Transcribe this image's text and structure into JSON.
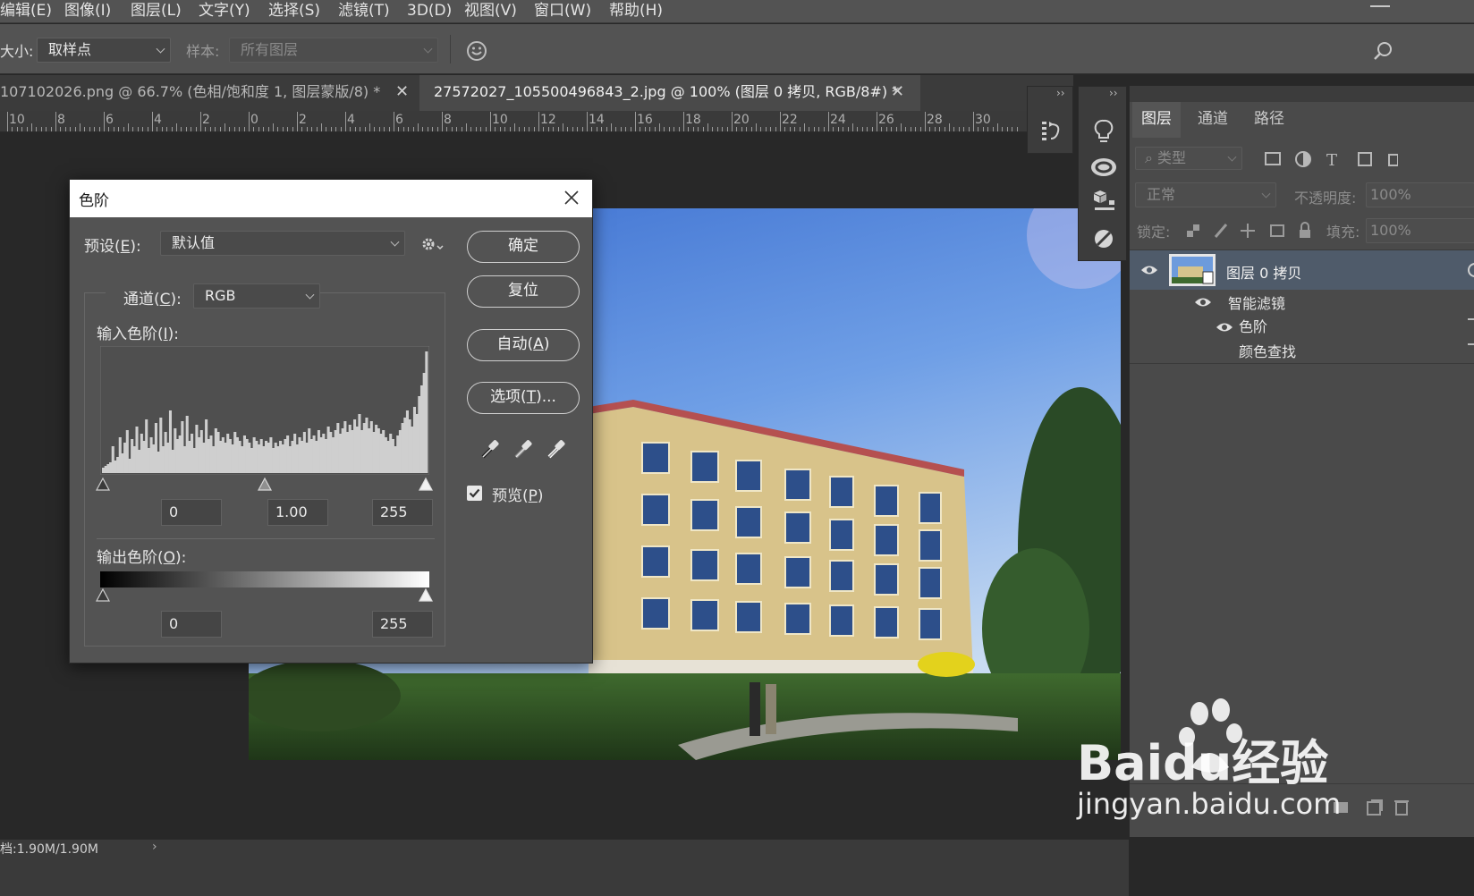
{
  "menu": {
    "items": [
      "编辑(E)",
      "图像(I)",
      "图层(L)",
      "文字(Y)",
      "选择(S)",
      "滤镜(T)",
      "3D(D)",
      "视图(V)",
      "窗口(W)",
      "帮助(H)"
    ]
  },
  "options": {
    "size_label": "大小:",
    "size_value": "取样点",
    "sample_label": "样本:",
    "sample_value": "所有图层"
  },
  "tabs": [
    {
      "label": "107102026.png @ 66.7% (色相/饱和度 1, 图层蒙版/8) *"
    },
    {
      "label": "27572027_105500496843_2.jpg @ 100% (图层 0 拷贝, RGB/8#) *"
    }
  ],
  "ruler": {
    "labels": [
      "10",
      "8",
      "6",
      "4",
      "2",
      "0",
      "2",
      "4",
      "6",
      "8",
      "10",
      "12",
      "14",
      "16",
      "18",
      "20",
      "22",
      "24",
      "26",
      "28",
      "30"
    ]
  },
  "dialog": {
    "title": "色阶",
    "preset_label": "预设(E):",
    "preset_value": "默认值",
    "channel_label": "通道(C):",
    "channel_value": "RGB",
    "input_label": "输入色阶(I):",
    "input_black": "0",
    "input_gamma": "1.00",
    "input_white": "255",
    "output_label": "输出色阶(O):",
    "output_black": "0",
    "output_white": "255",
    "ok": "确定",
    "reset": "复位",
    "auto": "自动(A)",
    "options": "选项(T)...",
    "preview_label": "预览(P)",
    "preview_checked": true,
    "histogram": [
      6,
      8,
      10,
      12,
      30,
      14,
      18,
      40,
      22,
      34,
      48,
      16,
      38,
      30,
      52,
      26,
      44,
      36,
      60,
      28,
      40,
      32,
      56,
      24,
      62,
      30,
      46,
      34,
      70,
      26,
      50,
      38,
      42,
      58,
      30,
      64,
      36,
      44,
      28,
      54,
      40,
      48,
      34,
      60,
      38,
      42,
      30,
      50,
      46,
      36,
      40,
      34,
      44,
      38,
      32,
      46,
      40,
      36,
      30,
      42,
      38,
      34,
      28,
      40,
      36,
      32,
      38,
      30,
      36,
      34,
      40,
      28,
      34,
      30,
      36,
      32,
      38,
      42,
      30,
      36,
      44,
      32,
      40,
      36,
      46,
      34,
      50,
      38,
      42,
      36,
      48,
      40,
      44,
      38,
      52,
      46,
      40,
      48,
      56,
      44,
      50,
      58,
      46,
      54,
      48,
      60,
      52,
      66,
      48,
      56,
      62,
      50,
      58,
      46,
      54,
      50,
      44,
      48,
      40,
      36,
      44,
      38,
      30,
      42,
      48,
      56,
      62,
      70,
      60,
      52,
      74,
      66,
      86,
      98,
      112,
      136
    ],
    "histogram_max": 140
  },
  "layers_panel": {
    "tabs": [
      "图层",
      "通道",
      "路径"
    ],
    "filter_label": "类型",
    "blend_mode": "正常",
    "opacity_label": "不透明度:",
    "opacity_value": "100%",
    "lock_label": "锁定:",
    "fill_label": "填充:",
    "fill_value": "100%",
    "layer_name": "图层 0 拷贝",
    "smart_filters_label": "智能滤镜",
    "filter_1": "色阶",
    "filter_2": "颜色查找"
  },
  "status": {
    "doc_size": "档:1.90M/1.90M"
  },
  "watermark": {
    "brand": "Baidu经验",
    "url": "jingyan.baidu.com"
  },
  "colors": {
    "ui_bg": "#535353",
    "panel_dark": "#3a3a3a",
    "selected_layer": "#4f5b6a"
  }
}
